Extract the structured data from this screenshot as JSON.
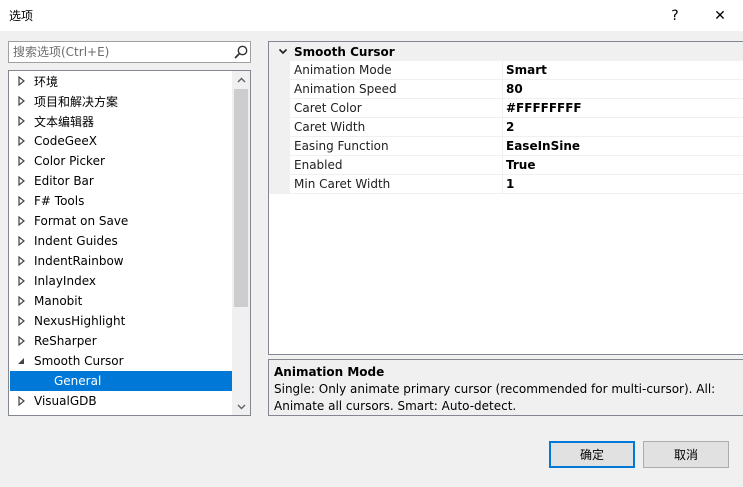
{
  "window": {
    "title": "选项",
    "help_glyph": "?",
    "close_glyph": "✕"
  },
  "search": {
    "placeholder": "搜索选项(Ctrl+E)"
  },
  "tree": {
    "items": [
      {
        "label": "环境",
        "expanded": false,
        "level": 0
      },
      {
        "label": "项目和解决方案",
        "expanded": false,
        "level": 0
      },
      {
        "label": "文本编辑器",
        "expanded": false,
        "level": 0
      },
      {
        "label": "CodeGeeX",
        "expanded": false,
        "level": 0
      },
      {
        "label": "Color Picker",
        "expanded": false,
        "level": 0
      },
      {
        "label": "Editor Bar",
        "expanded": false,
        "level": 0
      },
      {
        "label": "F# Tools",
        "expanded": false,
        "level": 0
      },
      {
        "label": "Format on Save",
        "expanded": false,
        "level": 0
      },
      {
        "label": "Indent Guides",
        "expanded": false,
        "level": 0
      },
      {
        "label": "IndentRainbow",
        "expanded": false,
        "level": 0
      },
      {
        "label": "InlayIndex",
        "expanded": false,
        "level": 0
      },
      {
        "label": "Manobit",
        "expanded": false,
        "level": 0
      },
      {
        "label": "NexusHighlight",
        "expanded": false,
        "level": 0
      },
      {
        "label": "ReSharper",
        "expanded": false,
        "level": 0
      },
      {
        "label": "Smooth Cursor",
        "expanded": true,
        "level": 0
      },
      {
        "label": "General",
        "expanded": null,
        "level": 1,
        "selected": true
      },
      {
        "label": "VisualGDB",
        "expanded": false,
        "level": 0
      }
    ]
  },
  "properties": {
    "category": "Smooth Cursor",
    "rows": [
      {
        "name": "Animation Mode",
        "value": "Smart"
      },
      {
        "name": "Animation Speed",
        "value": "80"
      },
      {
        "name": "Caret Color",
        "value": "#FFFFFFFF"
      },
      {
        "name": "Caret Width",
        "value": "2"
      },
      {
        "name": "Easing Function",
        "value": "EaseInSine"
      },
      {
        "name": "Enabled",
        "value": "True"
      },
      {
        "name": "Min Caret Width",
        "value": "1"
      }
    ]
  },
  "description": {
    "title": "Animation Mode",
    "text": "Single: Only animate primary cursor (recommended for multi-cursor). All: Animate all cursors. Smart: Auto-detect."
  },
  "buttons": {
    "ok": "确定",
    "cancel": "取消"
  },
  "colors": {
    "selection": "#0078d7",
    "default_button_border": "#0078d7"
  }
}
